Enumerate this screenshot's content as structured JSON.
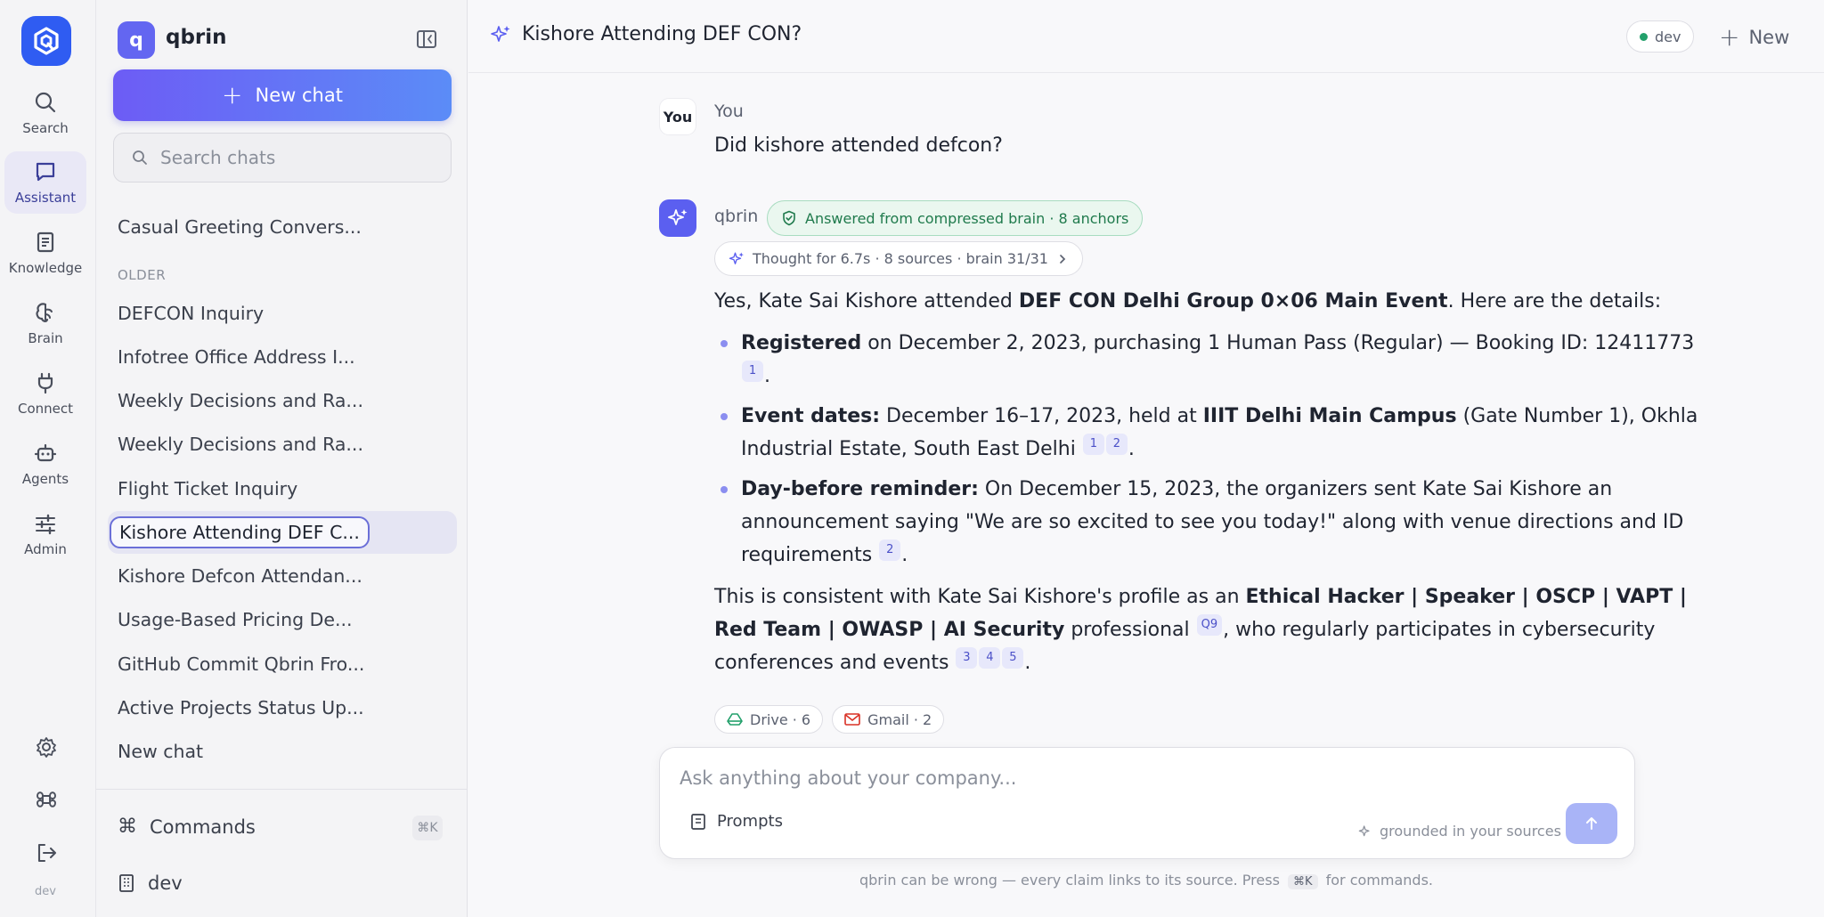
{
  "rail": {
    "items": [
      {
        "label": "Search",
        "icon": "search-icon"
      },
      {
        "label": "Assistant",
        "icon": "chat-icon"
      },
      {
        "label": "Knowledge",
        "icon": "document-icon"
      },
      {
        "label": "Brain",
        "icon": "brain-icon"
      },
      {
        "label": "Connect",
        "icon": "plug-icon"
      },
      {
        "label": "Agents",
        "icon": "robot-icon"
      },
      {
        "label": "Admin",
        "icon": "sliders-icon"
      }
    ],
    "active": "Assistant",
    "footer_label": "dev"
  },
  "sidebar": {
    "workspace_initial": "q",
    "workspace_name": "qbrin",
    "new_chat_label": "New chat",
    "search_placeholder": "Search chats",
    "recent": [
      "Casual Greeting Convers..."
    ],
    "section_label": "OLDER",
    "older": [
      "DEFCON Inquiry",
      "Infotree Office Address I...",
      "Weekly Decisions and Ra...",
      "Weekly Decisions and Ra...",
      "Flight Ticket Inquiry",
      "Kishore Attending DEF C...",
      "Kishore Defcon Attendan...",
      "Usage-Based Pricing De...",
      "GitHub Commit Qbrin Fro...",
      "Active Projects Status Up...",
      "New chat"
    ],
    "active_chat": "Kishore Attending DEF C...",
    "commands_label": "Commands",
    "commands_shortcut": "⌘K",
    "workspace_footer": "dev"
  },
  "header": {
    "title": "Kishore Attending DEF CON?",
    "env_label": "dev",
    "env_color": "#22a06b",
    "new_label": "New"
  },
  "conversation": {
    "user": {
      "avatar": "You",
      "name": "You",
      "message": "Did kishore attended defcon?"
    },
    "assistant": {
      "name": "qbrin",
      "badge": "Answered from compressed brain · 8 anchors",
      "thought": "Thought for 6.7s · 8 sources · brain 31/31",
      "intro_pre": "Yes, Kate Sai Kishore attended ",
      "intro_bold": "DEF CON Delhi Group 0×06 Main Event",
      "intro_post": ". Here are the details:",
      "bullets": {
        "b1_bold": "Registered",
        "b1_text": " on December 2, 2023, purchasing 1 Human Pass (Regular) — Booking ID: 12411773 ",
        "b1_cite": "1",
        "b2_bold": "Event dates:",
        "b2_text1": " December 16–17, 2023, held at ",
        "b2_bold2": "IIIT Delhi Main Campus",
        "b2_text2": " (Gate Number 1), Okhla Industrial Estate, South East Delhi ",
        "b2_cite1": "1",
        "b2_cite2": "2",
        "b3_bold": "Day-before reminder:",
        "b3_text": " On December 15, 2023, the organizers sent Kate Sai Kishore an announcement saying \"We are so excited to see you today!\" along with venue directions and ID requirements ",
        "b3_cite": "2"
      },
      "tail_pre": "This is consistent with Kate Sai Kishore's profile as an ",
      "tail_bold": "Ethical Hacker | Speaker | OSCP | VAPT | Red Team | OWASP | AI Security",
      "tail_mid": " professional ",
      "tail_cite_q": "Q9",
      "tail_post": ", who regularly participates in cybersecurity conferences and events ",
      "tail_cites": [
        "3",
        "4",
        "5"
      ],
      "sources": [
        {
          "label": "Drive · 6",
          "icon": "drive-icon"
        },
        {
          "label": "Gmail · 2",
          "icon": "gmail-icon"
        }
      ]
    }
  },
  "composer": {
    "placeholder": "Ask anything about your company...",
    "prompts_label": "Prompts",
    "grounded_label": "grounded in your sources"
  },
  "footer": {
    "pre": "qbrin can be wrong — every claim links to its source. Press",
    "kbd": "⌘K",
    "post": "for commands."
  }
}
